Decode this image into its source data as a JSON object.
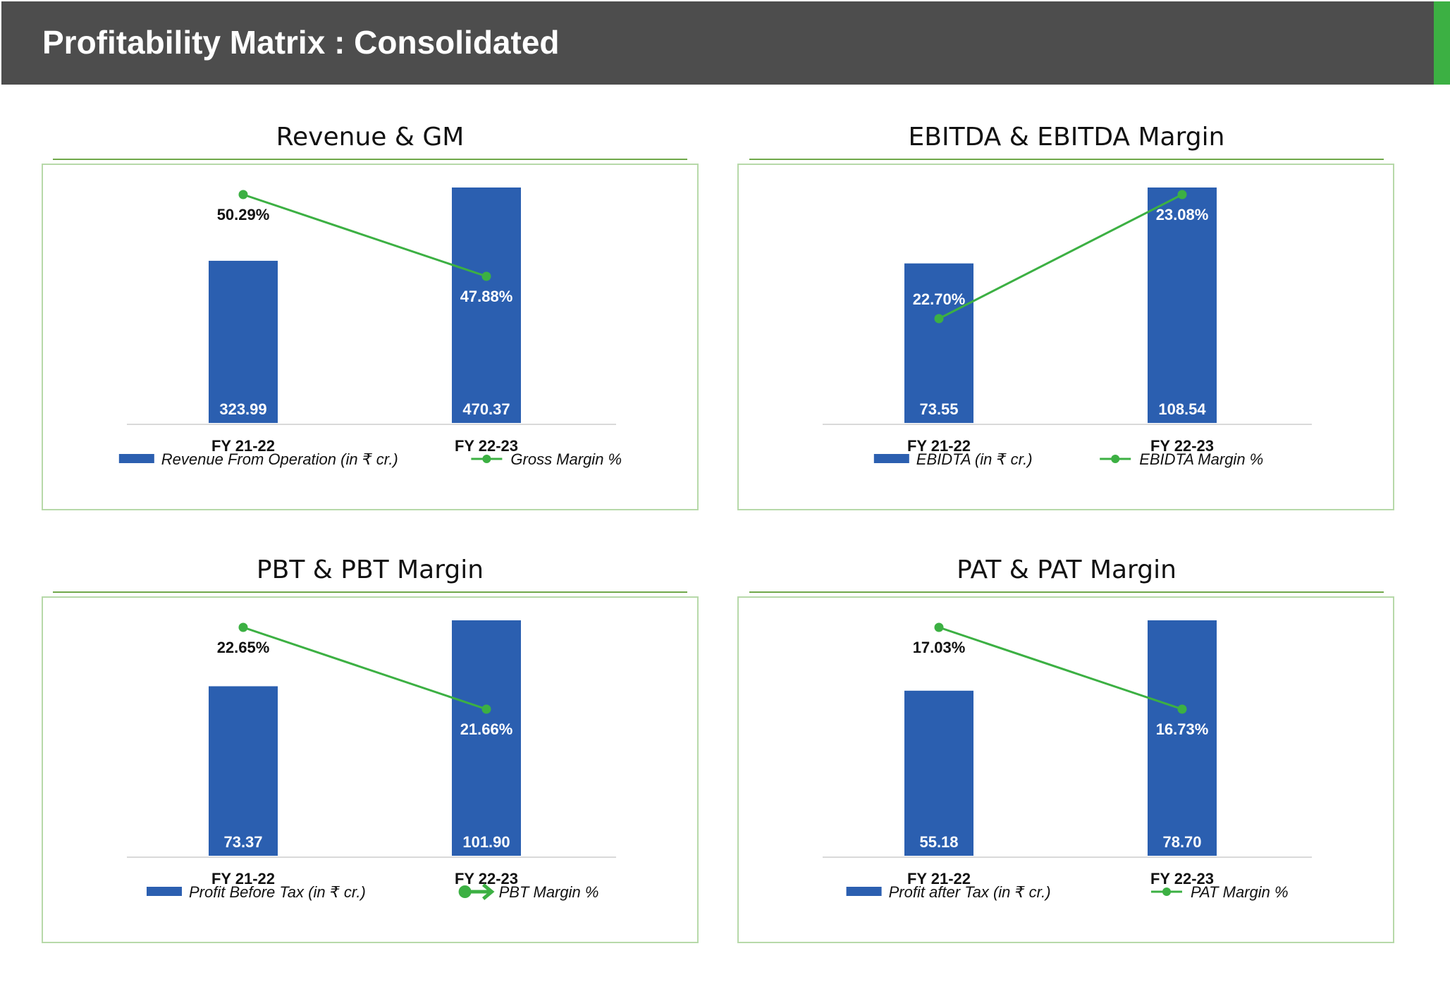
{
  "header": {
    "title": "Profitability Matrix : Consolidated"
  },
  "colors": {
    "bar": "#2b5fb0",
    "line": "#3cb043",
    "header_bg": "#4d4d4d",
    "accent": "#3cb043"
  },
  "chart_data": [
    {
      "type": "bar",
      "title": "Revenue & GM",
      "categories": [
        "FY 21-22",
        "FY 22-23"
      ],
      "series": [
        {
          "name": "Revenue From Operation (in ₹ cr.)",
          "type": "bar",
          "values": [
            323.99,
            470.37
          ],
          "labels": [
            "323.99",
            "470.37"
          ]
        },
        {
          "name": "Gross Margin %",
          "type": "line",
          "values": [
            50.29,
            47.88
          ],
          "labels": [
            "50.29%",
            "47.88%"
          ]
        }
      ],
      "legend_position": "bottom"
    },
    {
      "type": "bar",
      "title": "EBITDA & EBITDA Margin",
      "categories": [
        "FY 21-22",
        "FY 22-23"
      ],
      "series": [
        {
          "name": "EBIDTA (in ₹ cr.)",
          "type": "bar",
          "values": [
            73.55,
            108.54
          ],
          "labels": [
            "73.55",
            "108.54"
          ]
        },
        {
          "name": "EBIDTA Margin %",
          "type": "line",
          "values": [
            22.7,
            23.08
          ],
          "labels": [
            "22.70%",
            "23.08%"
          ]
        }
      ],
      "legend_position": "bottom"
    },
    {
      "type": "bar",
      "title": "PBT & PBT Margin",
      "categories": [
        "FY 21-22",
        "FY 22-23"
      ],
      "series": [
        {
          "name": "Profit Before Tax (in ₹ cr.)",
          "type": "bar",
          "values": [
            73.37,
            101.9
          ],
          "labels": [
            "73.37",
            "101.90"
          ]
        },
        {
          "name": "PBT Margin %",
          "type": "line",
          "values": [
            22.65,
            21.66
          ],
          "labels": [
            "22.65%",
            "21.66%"
          ]
        }
      ],
      "legend_position": "bottom"
    },
    {
      "type": "bar",
      "title": "PAT & PAT Margin",
      "categories": [
        "FY 21-22",
        "FY 22-23"
      ],
      "series": [
        {
          "name": "Profit after Tax (in ₹ cr.)",
          "type": "bar",
          "values": [
            55.18,
            78.7
          ],
          "labels": [
            "55.18",
            "78.70"
          ]
        },
        {
          "name": "PAT Margin %",
          "type": "line",
          "values": [
            17.03,
            16.73
          ],
          "labels": [
            "17.03%",
            "16.73%"
          ]
        }
      ],
      "legend_position": "bottom"
    }
  ]
}
